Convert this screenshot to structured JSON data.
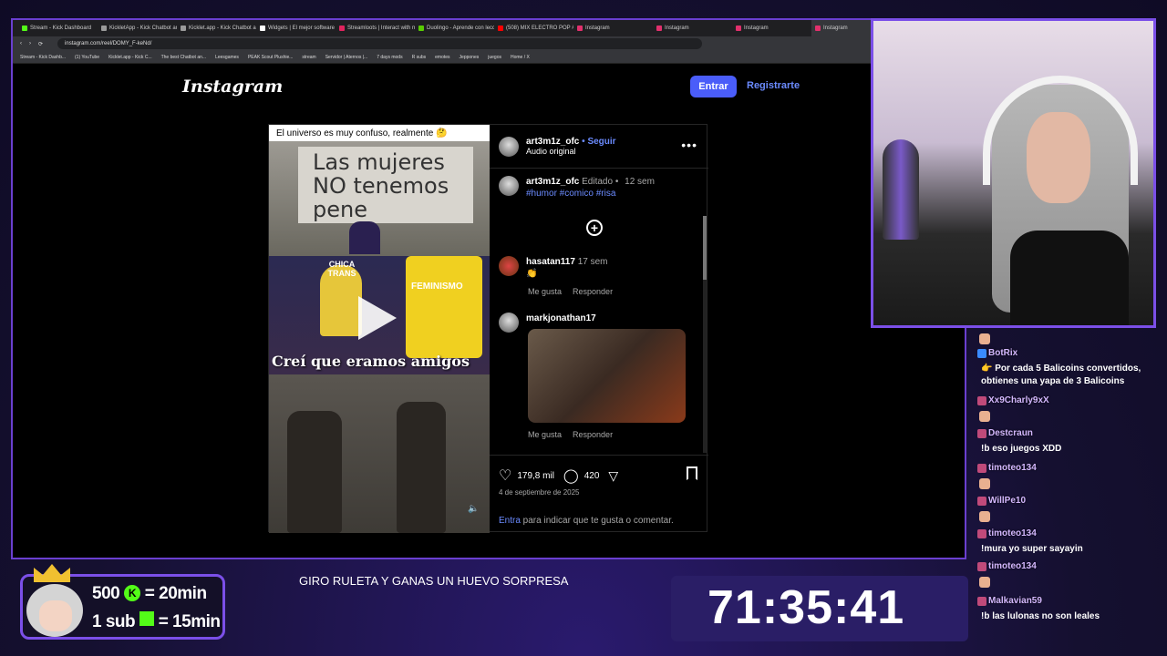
{
  "browser": {
    "tabs": [
      {
        "label": "Stream - Kick Dashboard",
        "color": "#53fc18",
        "active": false
      },
      {
        "label": "KickletApp - Kick Chatbot and",
        "color": "#9a9a9a",
        "active": false
      },
      {
        "label": "Kicklet.app - Kick Chatbot and",
        "color": "#9a9a9a",
        "active": false
      },
      {
        "label": "Widgets | El mejor software pa",
        "color": "#ffffff",
        "active": false
      },
      {
        "label": "Streamloots | Interact with mo",
        "color": "#e0245e",
        "active": false
      },
      {
        "label": "Duolingo - Aprende con lecció",
        "color": "#58cc02",
        "active": false
      },
      {
        "label": "(508) MIX ELECTRO POP #4 (D",
        "color": "#ff0000",
        "active": false
      },
      {
        "label": "Instagram",
        "color": "#e1306c",
        "active": false
      },
      {
        "label": "Instagram",
        "color": "#e1306c",
        "active": false
      },
      {
        "label": "Instagram",
        "color": "#e1306c",
        "active": false
      },
      {
        "label": "Instagram",
        "color": "#e1306c",
        "active": true
      }
    ],
    "url": "instagram.com/reel/DOMY_F-keNd/",
    "bookmarks": [
      "Stream - Kick Dashb...",
      "(1) YouTube",
      "Kicklet.app - Kick C...",
      "The best Chatbot an...",
      "Leesgames",
      "PEAK Scout Plushie...",
      "stream",
      "Servidor | Aternos |...",
      "7 days mods",
      "R subs",
      "emotes",
      "Jeppones",
      "juegos",
      "Home / X"
    ]
  },
  "instagram": {
    "logo": "Instagram",
    "login_label": "Entrar",
    "register_label": "Registrarte",
    "post": {
      "caption_top": "El universo es muy confuso, realmente 🤔",
      "meme1_text": "Las mujeres NO tenemos pene",
      "meme2_label_left": "CHICA TRANS",
      "meme2_label_right": "FEMINISMO",
      "meme2_bottom": "Creí que eramos amigos",
      "author": "art3m1z_ofc",
      "follow_sep": "•",
      "follow": "Seguir",
      "audio": "Audio original",
      "more": "•••",
      "desc_user": "art3m1z_ofc",
      "desc_edited": "Editado",
      "desc_sep": "•",
      "desc_time": "12 sem",
      "desc_tags": "#humor #comico #risa",
      "comments": [
        {
          "user": "hasatan117",
          "time": "17 sem",
          "text": "👏",
          "like": "Me gusta",
          "reply": "Responder"
        },
        {
          "user": "markjonathan17",
          "time": "",
          "text": "",
          "like": "Me gusta",
          "reply": "Responder"
        }
      ],
      "likes": "179,8 mil",
      "comment_count": "420",
      "date": "4 de septiembre de 2025",
      "login_link": "Entra",
      "login_text": " para indicar que te gusta o comentar."
    }
  },
  "overlay": {
    "promo_line1_a": "500",
    "promo_line1_b": "= 20min",
    "promo_line2_a": "1 sub",
    "promo_line2_b": "= 15min",
    "ticker": "GIRO RULETA Y GANAS UN HUEVO SORPRESA",
    "timer": "71:35:41"
  },
  "chat": [
    {
      "user": "BotRix",
      "text": "👉 Por cada 5 Balicoins convertidos, obtienes una yapa de 3 Balicoins"
    },
    {
      "user": "Xx9Charly9xX",
      "text": ""
    },
    {
      "user": "Destcraun",
      "text": "!b eso juegos XDD"
    },
    {
      "user": "timoteo134",
      "text": ""
    },
    {
      "user": "WillPe10",
      "text": ""
    },
    {
      "user": "timoteo134",
      "text": "!mura yo super sayayin"
    },
    {
      "user": "timoteo134",
      "text": ""
    },
    {
      "user": "Malkavian59",
      "text": "!b las lulonas no son leales"
    }
  ]
}
